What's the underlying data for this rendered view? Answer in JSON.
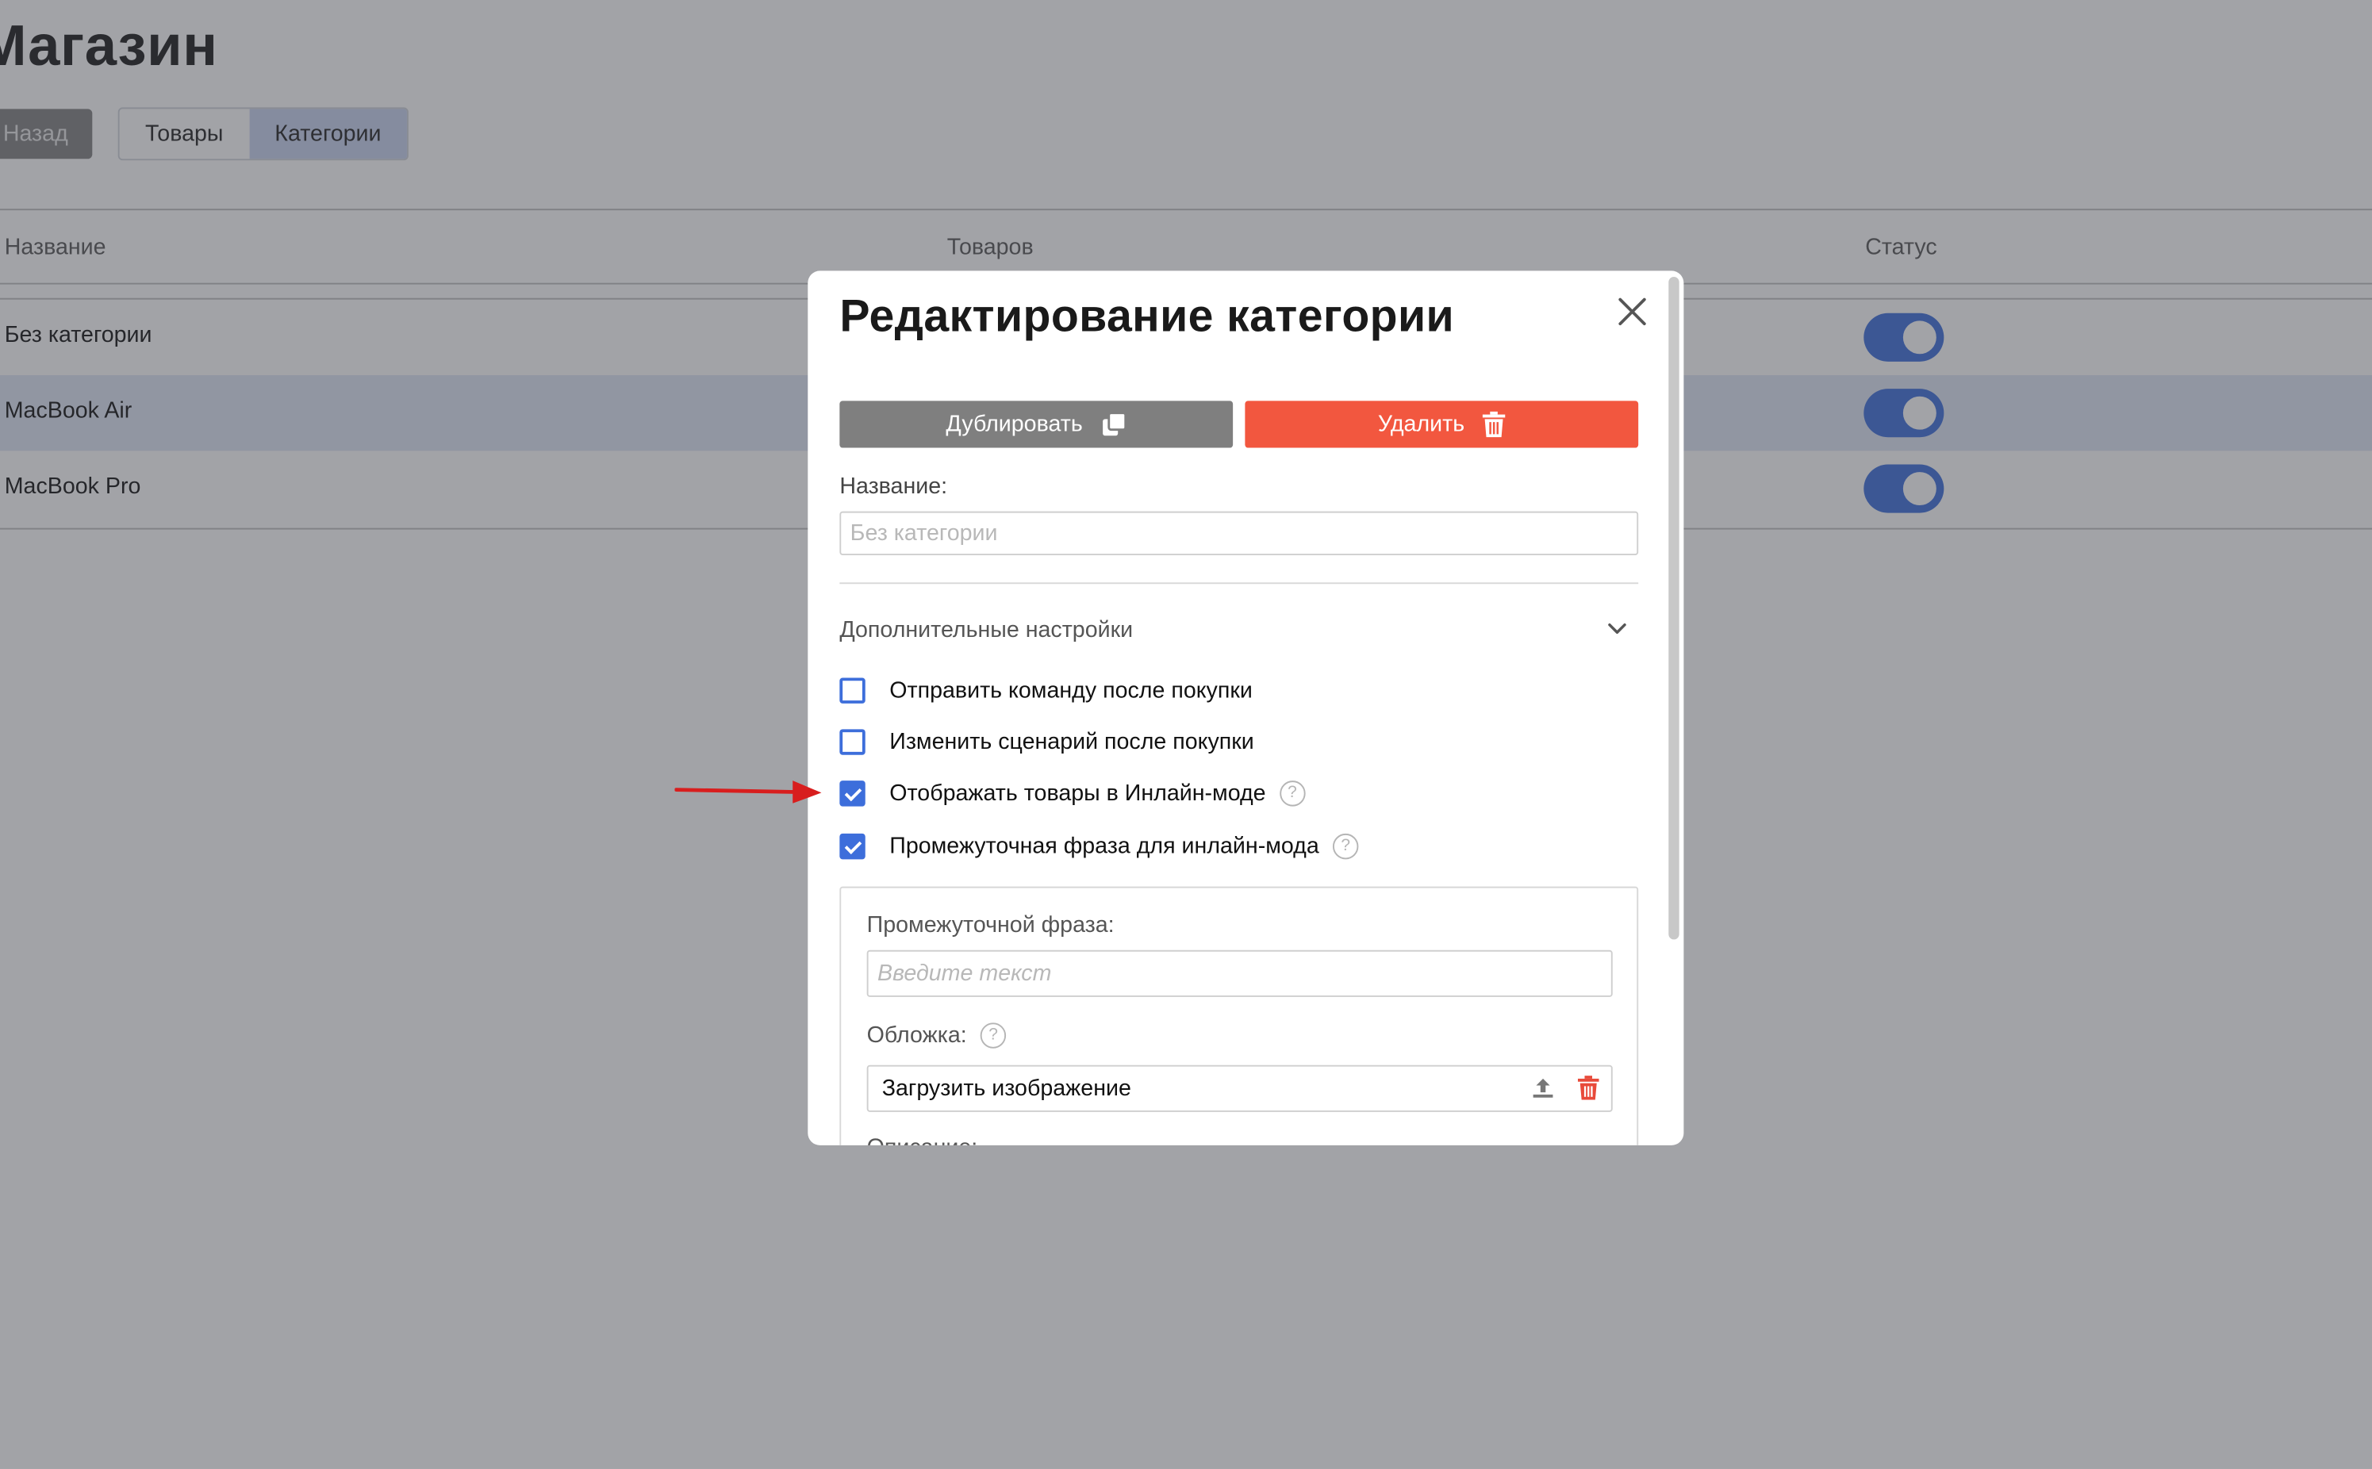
{
  "page": {
    "title": "Магазин",
    "back_label": "Назад",
    "tabs": [
      {
        "label": "Товары",
        "active": false
      },
      {
        "label": "Категории",
        "active": true
      }
    ]
  },
  "table": {
    "headers": {
      "name": "Название",
      "count": "Товаров",
      "status": "Статус"
    },
    "rows": [
      {
        "name": "Без категории",
        "status_on": true
      },
      {
        "name": "MacBook Air",
        "status_on": true
      },
      {
        "name": "MacBook Pro",
        "status_on": true
      }
    ]
  },
  "modal": {
    "title": "Редактирование категории",
    "close_icon": "close-icon",
    "duplicate_label": "Дублировать",
    "delete_label": "Удалить",
    "name_label": "Название:",
    "name_placeholder": "Без категории",
    "advanced_label": "Дополнительные настройки",
    "options": [
      {
        "label": "Отправить команду после покупки",
        "checked": false,
        "help": false
      },
      {
        "label": "Изменить сценарий после покупки",
        "checked": false,
        "help": false
      },
      {
        "label": "Отображать товары в Инлайн-моде",
        "checked": true,
        "help": true
      },
      {
        "label": "Промежуточная фраза для инлайн-мода",
        "checked": true,
        "help": true
      }
    ],
    "phrase_label": "Промежуточной фраза:",
    "phrase_placeholder": "Введите текст",
    "cover_label": "Обложка:",
    "upload_label": "Загрузить изображение",
    "description_label": "Описание:",
    "help_glyph": "?"
  },
  "colors": {
    "accent": "#3d6edb",
    "danger": "#f2573f",
    "annotation_arrow": "#d81e1e"
  }
}
